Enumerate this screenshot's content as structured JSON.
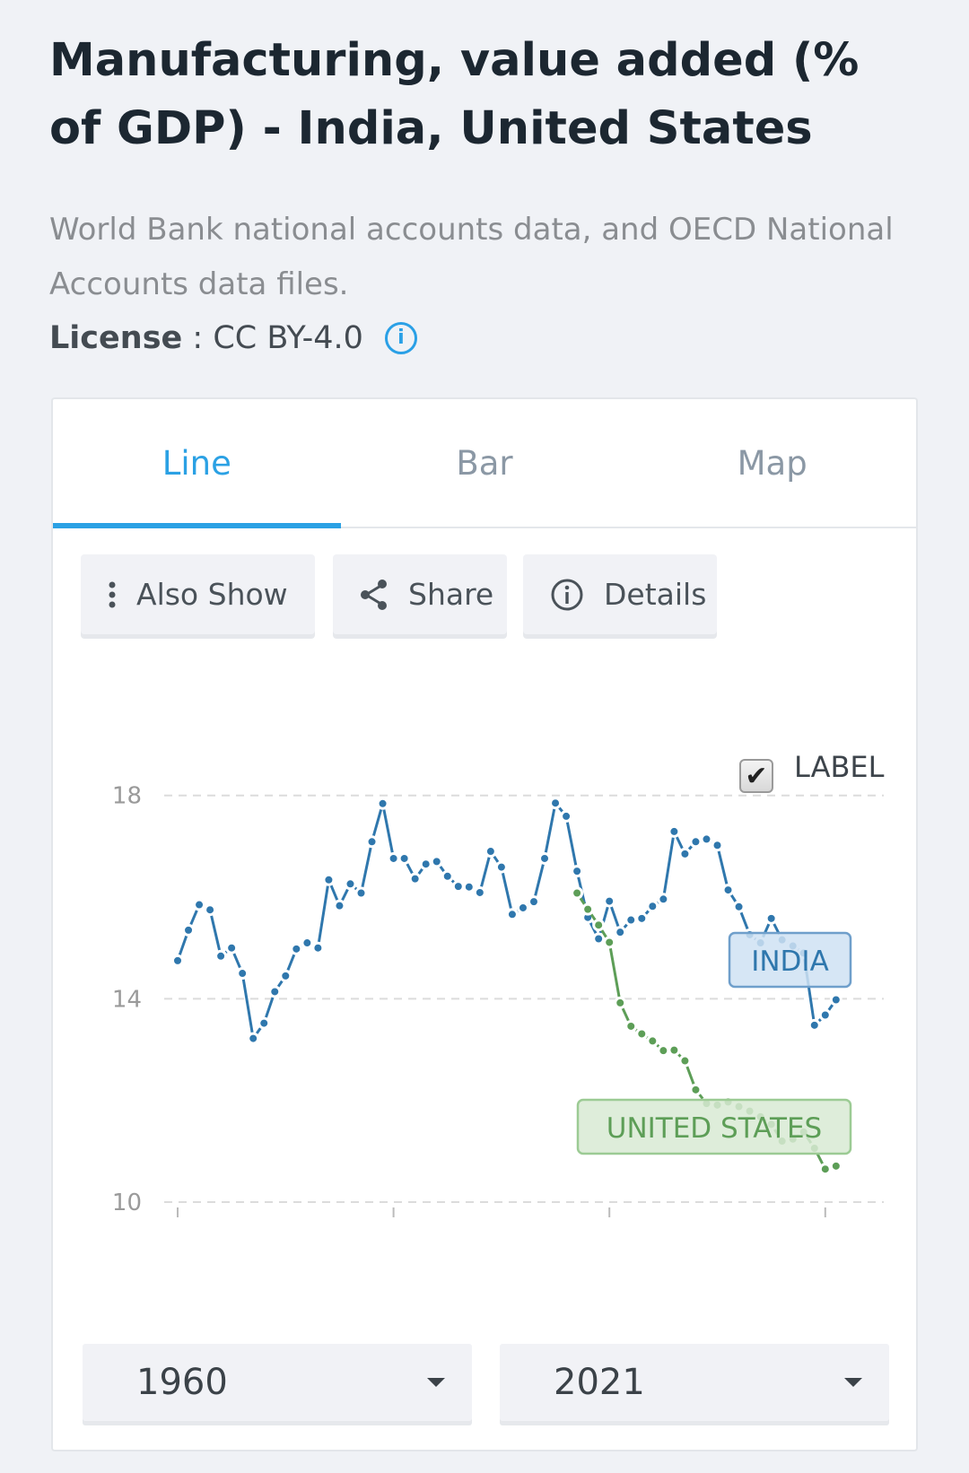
{
  "header": {
    "title": "Manufacturing, value added (% of GDP) - India, United States",
    "source": "World Bank national accounts data, and OECD National Accounts data files.",
    "license_label": "License",
    "license_sep": " : ",
    "license_value": "CC BY-4.0",
    "info_icon": "info-circle-icon"
  },
  "tabs": [
    {
      "label": "Line",
      "active": true
    },
    {
      "label": "Bar",
      "active": false
    },
    {
      "label": "Map",
      "active": false
    }
  ],
  "toolbar": {
    "also_show": "Also Show",
    "share": "Share",
    "details": "Details"
  },
  "label_toggle": {
    "label": "LABEL",
    "checked": true,
    "check_glyph": "✔"
  },
  "range": {
    "start": "1960",
    "end": "2021"
  },
  "colors": {
    "accent": "#2ba1e4",
    "india": "#2f77ad",
    "us": "#5d9e57"
  },
  "chart_data": {
    "type": "line",
    "title": "",
    "xlabel": "",
    "ylabel": "",
    "xlim": [
      1960,
      2021
    ],
    "ylim": [
      10,
      18
    ],
    "yticks": [
      "18",
      "14",
      "10"
    ],
    "xticks": [
      1960,
      1980,
      2000,
      2020
    ],
    "grid": true,
    "series": [
      {
        "name": "INDIA",
        "color": "#2f77ad",
        "start_year": 1960,
        "values": [
          14.75,
          15.35,
          15.85,
          15.75,
          14.84,
          15.0,
          14.5,
          13.22,
          13.52,
          14.14,
          14.45,
          14.98,
          15.1,
          15.0,
          16.34,
          15.83,
          16.26,
          16.08,
          17.09,
          17.84,
          16.76,
          16.76,
          16.36,
          16.65,
          16.7,
          16.41,
          16.21,
          16.2,
          16.09,
          16.9,
          16.59,
          15.66,
          15.79,
          15.91,
          16.76,
          17.85,
          17.59,
          16.51,
          15.6,
          15.18,
          15.92,
          15.31,
          15.55,
          15.58,
          15.82,
          15.96,
          17.29,
          16.85,
          17.09,
          17.14,
          17.02,
          16.14,
          15.81,
          15.26,
          15.1,
          15.58,
          15.16,
          15.04,
          14.9,
          13.48,
          13.68,
          13.98
        ]
      },
      {
        "name": "UNITED STATES",
        "color": "#5d9e57",
        "start_year": 1997,
        "values": [
          16.08,
          15.76,
          15.45,
          15.11,
          13.92,
          13.46,
          13.31,
          13.17,
          12.98,
          12.99,
          12.78,
          12.21,
          11.94,
          11.91,
          11.97,
          11.88,
          11.79,
          11.68,
          11.53,
          11.2,
          11.24,
          11.38,
          11.06,
          10.65,
          10.71
        ]
      }
    ]
  }
}
